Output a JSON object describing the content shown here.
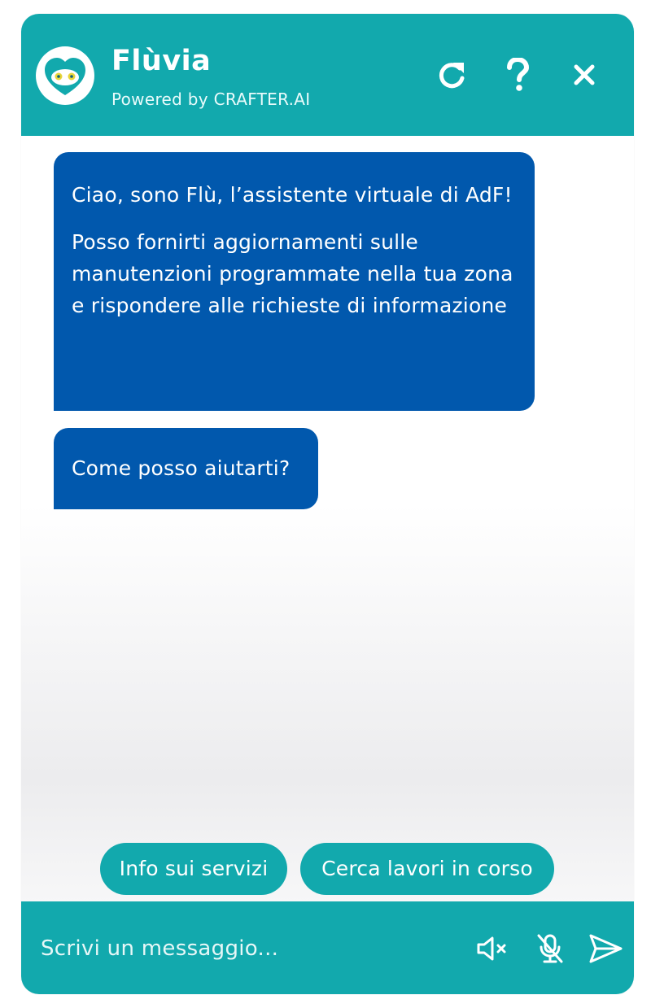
{
  "header": {
    "title": "Flùvia",
    "subtitle": "Powered by CRAFTER.AI",
    "logo_icon": "owl-heart-icon",
    "actions": [
      {
        "name": "refresh-button",
        "icon": "refresh-icon"
      },
      {
        "name": "help-button",
        "icon": "question-icon"
      },
      {
        "name": "close-button",
        "icon": "close-icon"
      }
    ]
  },
  "messages": [
    {
      "from": "bot",
      "paragraphs": [
        "Ciao, sono Flù, l’assistente virtuale di AdF!",
        "Posso fornirti aggiornamenti sulle manutenzioni programmate nella tua zona e rispondere alle richieste di informazione"
      ]
    },
    {
      "from": "bot",
      "paragraphs": [
        "Come posso aiutarti?"
      ]
    }
  ],
  "quick_replies": [
    "Info sui servizi",
    "Cerca lavori in corso"
  ],
  "composer": {
    "placeholder": "Scrivi un messaggio...",
    "actions": [
      {
        "name": "mute-button",
        "icon": "speaker-muted-icon"
      },
      {
        "name": "microphone-button",
        "icon": "microphone-off-icon"
      },
      {
        "name": "send-button",
        "icon": "send-icon"
      }
    ]
  },
  "colors": {
    "teal": "#12a9ad",
    "bubble_blue": "#0158ad",
    "white": "#ffffff"
  }
}
